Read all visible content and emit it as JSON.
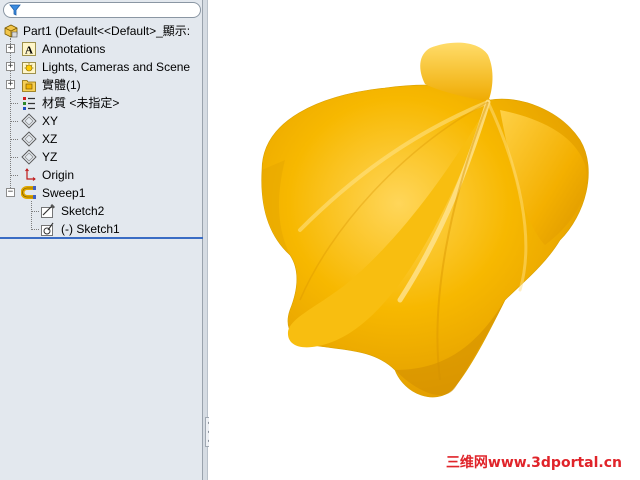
{
  "feature_tree": {
    "filter_icon": "filter-icon",
    "items": [
      {
        "label": "Part1  (Default<<Default>_顯示:",
        "icon": "part-icon"
      },
      {
        "label": "Annotations",
        "icon": "annotations-icon"
      },
      {
        "label": "Lights, Cameras and Scene",
        "icon": "lights-cameras-icon"
      },
      {
        "label": "實體(1)",
        "icon": "solid-bodies-icon"
      },
      {
        "label": "材質 <未指定>",
        "icon": "material-icon"
      },
      {
        "label": "XY",
        "icon": "plane-icon"
      },
      {
        "label": "XZ",
        "icon": "plane-icon"
      },
      {
        "label": "YZ",
        "icon": "plane-icon"
      },
      {
        "label": "Origin",
        "icon": "origin-icon"
      },
      {
        "label": "Sweep1",
        "icon": "sweep-icon"
      },
      {
        "label": "Sketch2",
        "icon": "sketch-icon"
      },
      {
        "label": "(-) Sketch1",
        "icon": "sketch-icon"
      }
    ]
  },
  "viewport": {
    "model_color": "#f5b400",
    "watermark": "三维网www.3dportal.cn",
    "watermark_color": "#e0242a"
  }
}
